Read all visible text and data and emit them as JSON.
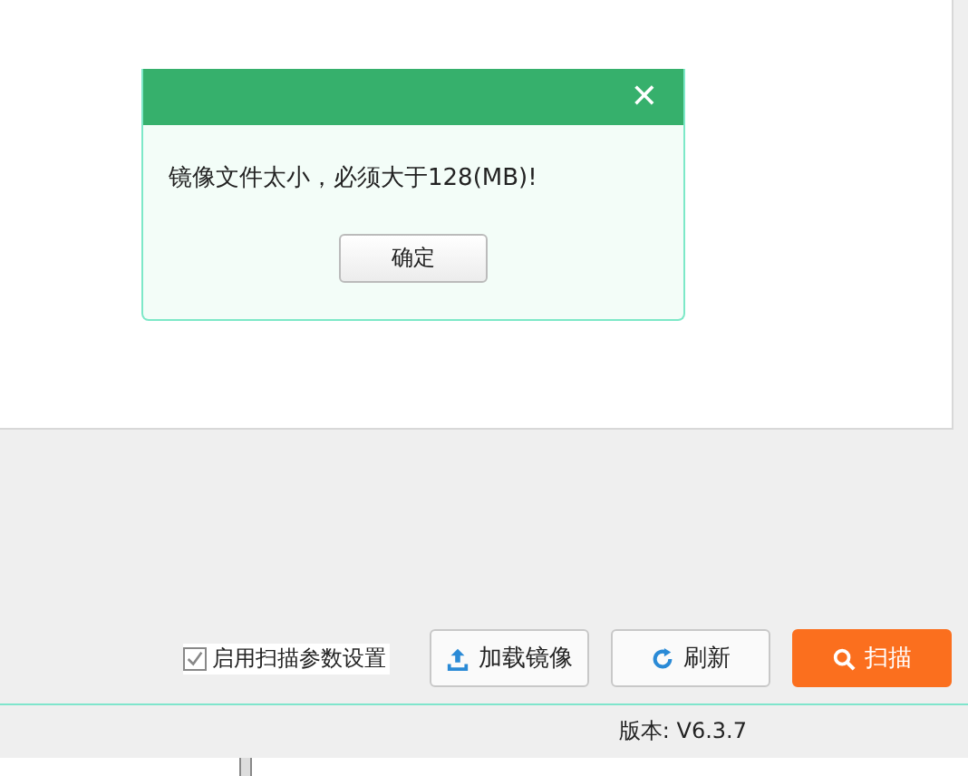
{
  "dialog": {
    "close": "✕",
    "message": "镜像文件太小，必须大于128(MB)!",
    "ok_button": "确定"
  },
  "toolbar": {
    "scan_params": {
      "label": "启用扫描参数设置",
      "checked": true
    },
    "buttons": [
      {
        "kind": "upload",
        "label": "加载镜像"
      },
      {
        "kind": "refresh",
        "label": "刷新"
      },
      {
        "kind": "scan",
        "label": "扫描"
      }
    ]
  },
  "status_bar": {
    "version": "版本: V6.3.7"
  }
}
